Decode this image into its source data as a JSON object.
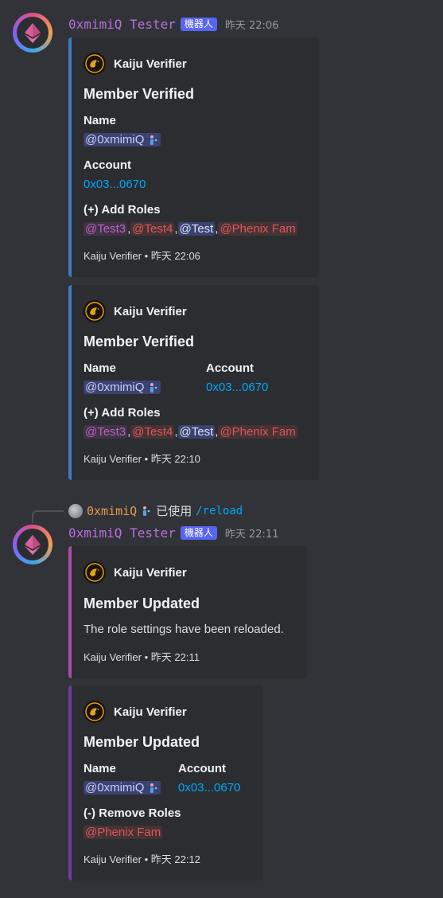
{
  "messages": [
    {
      "username": "0xmimiQ Tester",
      "bot_tag": "機器人",
      "timestamp": "昨天 22:06",
      "embeds": [
        {
          "author": "Kaiju Verifier",
          "title": "Member Verified",
          "fields": [
            {
              "name": "Name",
              "value": "@0xmimiQ"
            },
            {
              "name": "Account",
              "value": "0x03...0670"
            },
            {
              "name": "(+) Add Roles",
              "roles": [
                "@Test3",
                "@Test4",
                "@Test",
                "@Phenix Fam"
              ]
            }
          ],
          "footer": "Kaiju Verifier • 昨天 22:06",
          "color": "#3f7bc4"
        },
        {
          "author": "Kaiju Verifier",
          "title": "Member Verified",
          "fields": [
            {
              "name": "Name",
              "value": "@0xmimiQ"
            },
            {
              "name": "Account",
              "value": "0x03...0670"
            },
            {
              "name": "(+) Add Roles",
              "roles": [
                "@Test3",
                "@Test4",
                "@Test",
                "@Phenix Fam"
              ]
            }
          ],
          "footer": "Kaiju Verifier • 昨天 22:10",
          "color": "#3f7bc4"
        }
      ]
    },
    {
      "reply": {
        "user": "0xmimiQ",
        "used": "已使用",
        "command": "/reload"
      },
      "username": "0xmimiQ Tester",
      "bot_tag": "機器人",
      "timestamp": "昨天 22:11",
      "embeds": [
        {
          "author": "Kaiju Verifier",
          "title": "Member Updated",
          "description": "The role settings have been reloaded.",
          "footer": "Kaiju Verifier • 昨天 22:11",
          "color": "#b04aa8"
        },
        {
          "author": "Kaiju Verifier",
          "title": "Member Updated",
          "fields": [
            {
              "name": "Name",
              "value": "@0xmimiQ"
            },
            {
              "name": "Account",
              "value": "0x03...0670"
            },
            {
              "name": "(-) Remove Roles",
              "roles": [
                "@Phenix Fam"
              ]
            }
          ],
          "footer": "Kaiju Verifier • 昨天 22:12",
          "color": "#6a3fa0"
        }
      ]
    }
  ],
  "colors": {
    "background": "#313338",
    "embed_bg": "#2b2d31",
    "username": "#b96fdc",
    "bot_tag": "#5865f2",
    "link": "#00a8fc",
    "role_pink": "#b960c3",
    "role_red": "#e05757"
  },
  "icons": {
    "avatar": "ethereum-logo-icon",
    "embed_author": "dragon-icon",
    "mention_suffix": "person-icon"
  }
}
